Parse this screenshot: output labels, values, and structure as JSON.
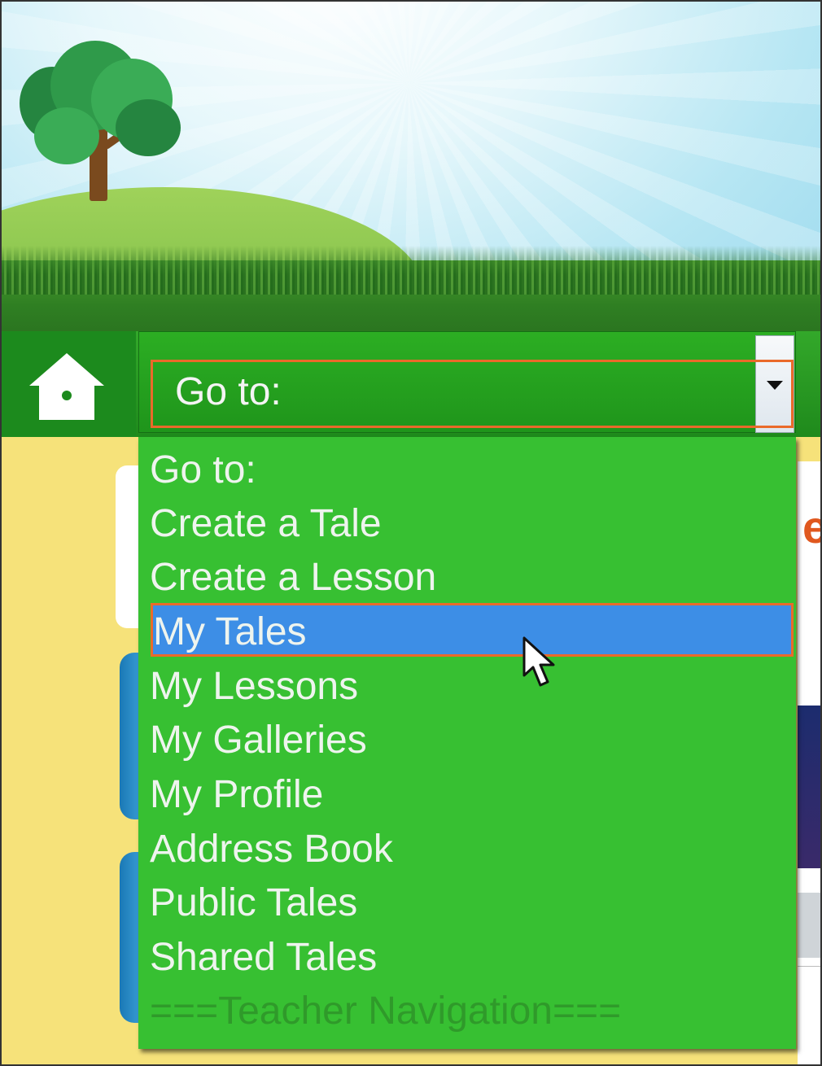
{
  "header": {
    "home_icon": "home-icon"
  },
  "goto_select": {
    "value": "Go to:",
    "arrow_icon": "chevron-down-icon"
  },
  "dropdown": {
    "options": [
      "Go to:",
      "Create a Tale",
      "Create a Lesson",
      "My Tales",
      "My Lessons",
      "My Galleries",
      "My Profile",
      "Address Book",
      "Public Tales",
      "Shared Tales",
      "===Teacher Navigation==="
    ],
    "selected_option": "My Tales",
    "disabled_option": "===Teacher Navigation==="
  },
  "background": {
    "partial_heading_letter": "e"
  },
  "colors": {
    "nav_green": "#1f8a1c",
    "dropdown_green": "#37c032",
    "selection_blue": "#3d8ee6",
    "highlight_orange": "#ea6a2a"
  }
}
